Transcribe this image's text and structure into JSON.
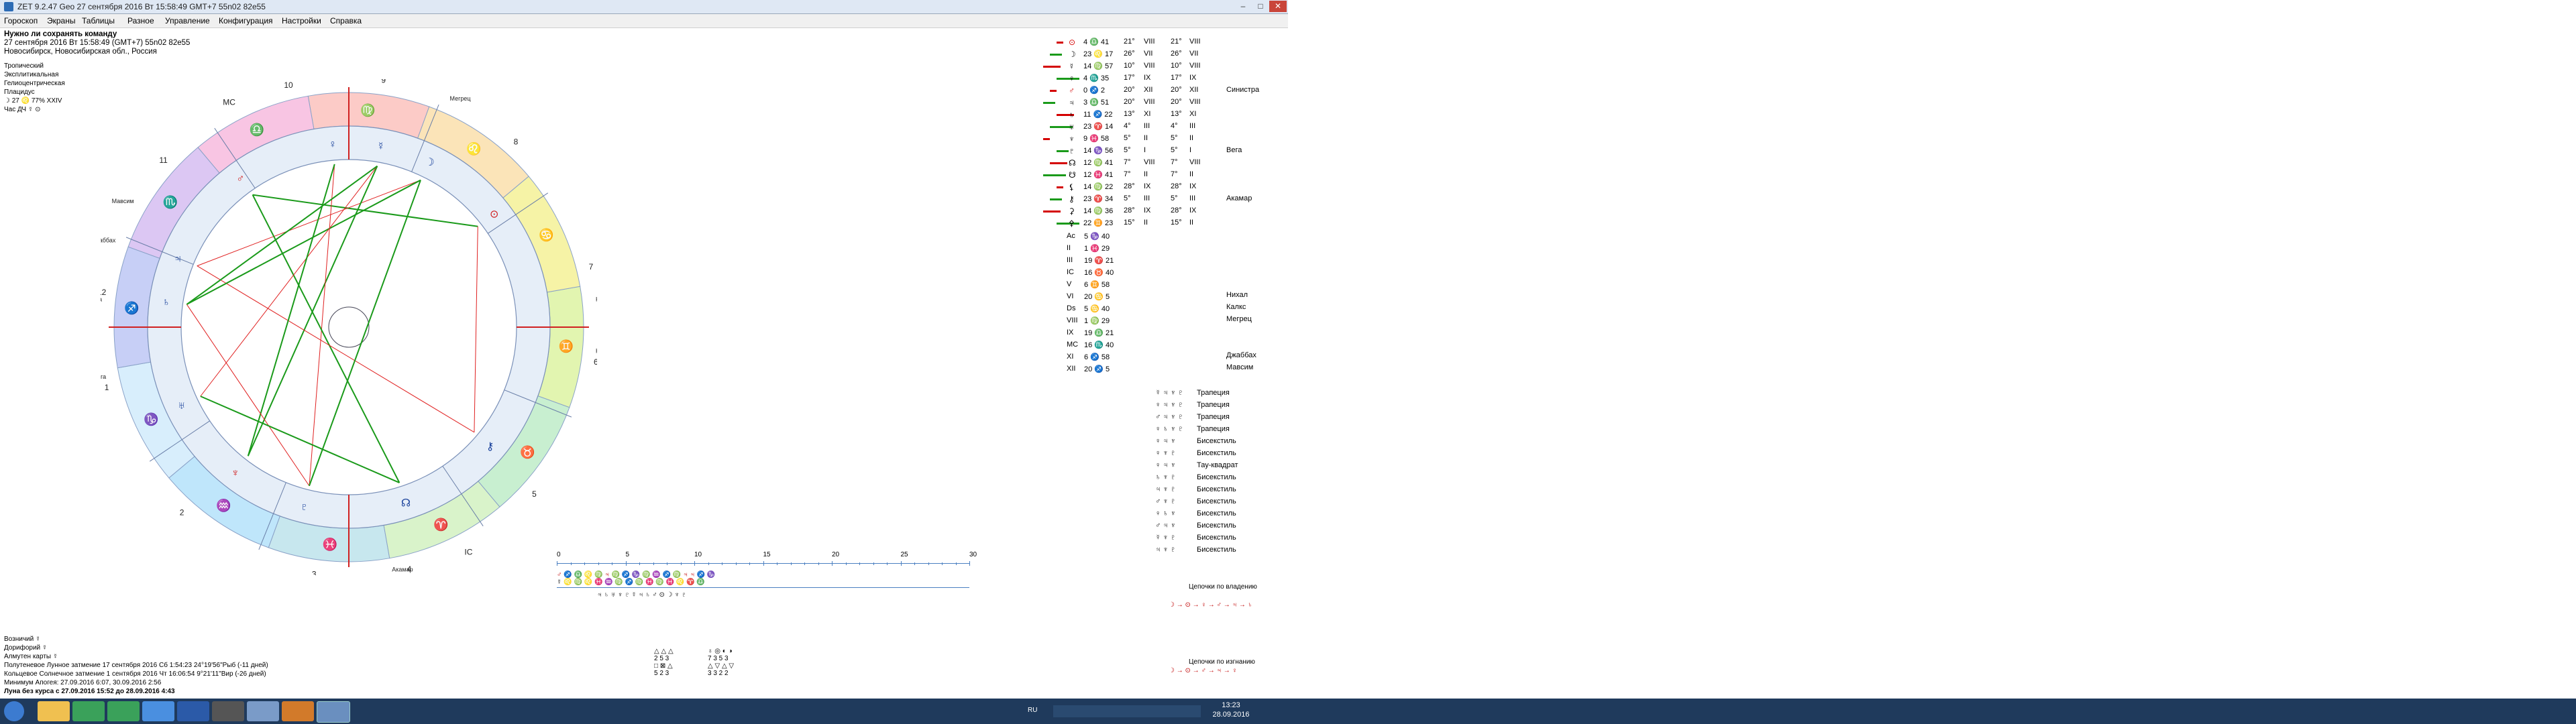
{
  "window": {
    "title": "ZET 9.2.47 Geo    27 сентября 2016  Вт  15:58:49 GMT+7 55n02  82e55",
    "controls": [
      "–",
      "□",
      "✕"
    ]
  },
  "menu": [
    "Гороскоп",
    "Экраны",
    "Таблицы",
    "Разное",
    "Управление",
    "Конфигурация",
    "Настройки",
    "Справка"
  ],
  "header": {
    "title": "Нужно ли сохранять команду",
    "datetime": "27 сентября 2016  Вт  15:58:49 (GMT+7) 55n02  82e55",
    "place": "Новосибирск, Новосибирская обл., Россия",
    "zodiac": "Тропический",
    "houses": "Эксплитикальная",
    "system": "Гелиоцентрическая",
    "extra": "Плацидус",
    "moon_line": "☽ 27 ♌ 77% XXIV",
    "hour_line": "Час ДЧ ☿ ⊙"
  },
  "bottom_info": {
    "line1": "Возничий ☿",
    "line2": "Дорифорий ☿",
    "line3": "Алмутен карты ☿",
    "line4": "Полутеневое Лунное затмение 17 сентября 2016 Сб  1:54:23 24°19'56\"Рыб (-11 дней)",
    "line5": "Кольцевое Солнечное затмение 1 сентября 2016 Чт 16:06:54  9°21'11\"Вир (-26 дней)",
    "line6": "Минимум Апогея: 27.09.2016  6:07,  30.09.2016  2:56",
    "line7": "Луна без курса с 27.09.2016 15:52 до 28.09.2016  4:43"
  },
  "element_table": {
    "row1_symbols": "△ △ △",
    "row1_values": "2 5 3",
    "row2_symbols": "□ ⊠ △",
    "row2_values": "5 2 3",
    "row3_symbols": "♁ ◎ ◐ ◑",
    "row3_values": "7 3 5 3",
    "row4_symbols": "△ ▽ △ ▽",
    "row4_values": "3 3 2 2"
  },
  "planets": [
    {
      "glyph": "⊙",
      "pos": "4 ♎ 41",
      "deg": "21°",
      "house": "VIII",
      "deg2": "21°",
      "house2": "VIII",
      "color": "#d40000"
    },
    {
      "glyph": "☽",
      "pos": "23 ♌ 17",
      "deg": "26°",
      "house": "VII",
      "deg2": "26°",
      "house2": "VII",
      "color": "#000"
    },
    {
      "glyph": "☿",
      "pos": "14 ♍ 57",
      "deg": "10°",
      "house": "VIII",
      "deg2": "10°",
      "house2": "VIII",
      "color": "#000"
    },
    {
      "glyph": "♀",
      "pos": "4 ♏ 35",
      "deg": "17°",
      "house": "IX",
      "deg2": "17°",
      "house2": "IX",
      "color": "#000"
    },
    {
      "glyph": "♂",
      "pos": "0 ♐ 2",
      "deg": "20°",
      "house": "XII",
      "deg2": "20°",
      "house2": "XII",
      "color": "#d40000"
    },
    {
      "glyph": "♃",
      "pos": "3 ♎ 51",
      "deg": "20°",
      "house": "VIII",
      "deg2": "20°",
      "house2": "VIII",
      "color": "#000"
    },
    {
      "glyph": "♄",
      "pos": "11 ♐ 22",
      "deg": "13°",
      "house": "XI",
      "deg2": "13°",
      "house2": "XI",
      "color": "#000"
    },
    {
      "glyph": "♅",
      "pos": "23 ♈ 14",
      "deg": "4°",
      "house": "III",
      "deg2": "4°",
      "house2": "III",
      "color": "#000"
    },
    {
      "glyph": "♆",
      "pos": "9 ♓ 58",
      "deg": "5°",
      "house": "II",
      "deg2": "5°",
      "house2": "II",
      "color": "#000"
    },
    {
      "glyph": "♇",
      "pos": "14 ♑ 56",
      "deg": "5°",
      "house": "I",
      "deg2": "5°",
      "house2": "I",
      "color": "#000"
    },
    {
      "glyph": "☊",
      "pos": "12 ♍ 41",
      "deg": "7°",
      "house": "VIII",
      "deg2": "7°",
      "house2": "VIII",
      "color": "#000"
    },
    {
      "glyph": "☋",
      "pos": "12 ♓ 41",
      "deg": "7°",
      "house": "II",
      "deg2": "7°",
      "house2": "II",
      "color": "#000"
    },
    {
      "glyph": "⚸",
      "pos": "14 ♍ 22",
      "deg": "28°",
      "house": "IX",
      "deg2": "28°",
      "house2": "IX",
      "color": "#000"
    },
    {
      "glyph": "⚷",
      "pos": "23 ♈ 34",
      "deg": "5°",
      "house": "III",
      "deg2": "5°",
      "house2": "III",
      "color": "#000"
    },
    {
      "glyph": "⚳",
      "pos": "14 ♍ 36",
      "deg": "28°",
      "house": "IX",
      "deg2": "28°",
      "house2": "IX",
      "color": "#000"
    },
    {
      "glyph": "⚴",
      "pos": "22 ♊ 23",
      "deg": "15°",
      "house": "II",
      "deg2": "15°",
      "house2": "II",
      "color": "#000"
    }
  ],
  "cusps": [
    {
      "glyph": "Ac",
      "pos": "5 ♑ 40"
    },
    {
      "glyph": "II",
      "pos": "1 ♓ 29"
    },
    {
      "glyph": "III",
      "pos": "19 ♈ 21"
    },
    {
      "glyph": "IC",
      "pos": "16 ♉ 40"
    },
    {
      "glyph": "V",
      "pos": "6 ♊ 58"
    },
    {
      "glyph": "VI",
      "pos": "20 ♋ 5"
    },
    {
      "glyph": "Ds",
      "pos": "5 ♋ 40"
    },
    {
      "glyph": "VIII",
      "pos": "1 ♍ 29"
    },
    {
      "glyph": "IX",
      "pos": "19 ♎ 21"
    },
    {
      "glyph": "MC",
      "pos": "16 ♏ 40"
    },
    {
      "glyph": "XI",
      "pos": "6 ♐ 58"
    },
    {
      "glyph": "XII",
      "pos": "20 ♐ 5"
    }
  ],
  "stars": [
    {
      "label": "Синистра",
      "row": 4
    },
    {
      "label": "Вега",
      "row": 9
    },
    {
      "label": "Акамар",
      "row": 13
    },
    {
      "label": "Нихал",
      "row": 21
    },
    {
      "label": "Калкс",
      "row": 22
    },
    {
      "label": "Мегрец",
      "row": 23
    },
    {
      "label": "Джаббах",
      "row": 26
    },
    {
      "label": "Мавсим",
      "row": 27
    }
  ],
  "configurations": [
    {
      "glyphs": "☿ ♃ ♆ ♇",
      "name": "Трапеция"
    },
    {
      "glyphs": "♀ ♃ ♆ ♇",
      "name": "Трапеция"
    },
    {
      "glyphs": "♂ ♃ ♆ ♇",
      "name": "Трапеция"
    },
    {
      "glyphs": "♀ ♄ ♆ ♇",
      "name": "Трапеция"
    },
    {
      "glyphs": "♀ ♃ ♆",
      "name": "Бисекстиль"
    },
    {
      "glyphs": "♀ ♆ ♇",
      "name": "Бисекстиль"
    },
    {
      "glyphs": "♀ ♃ ♆",
      "name": "Тау-квадрат"
    },
    {
      "glyphs": "♄ ♆ ♇",
      "name": "Бисекстиль"
    },
    {
      "glyphs": "♃ ♆ ♇",
      "name": "Бисекстиль"
    },
    {
      "glyphs": "♂ ♆ ♇",
      "name": "Бисекстиль"
    },
    {
      "glyphs": "♀ ♄ ♆",
      "name": "Бисекстиль"
    },
    {
      "glyphs": "♂ ♃ ♆",
      "name": "Бисекстиль"
    },
    {
      "glyphs": "☿ ♆ ♇",
      "name": "Бисекстиль"
    },
    {
      "glyphs": "♃ ♆ ♇",
      "name": "Бисекстиль"
    }
  ],
  "chains": {
    "label1": "Цепочки по владению",
    "chain1": "☽ → ⊙ → ♀ → ♂ → ♃ → ♄",
    "label2": "Цепочки по изгнанию",
    "chain2": "☽ → ⊙ → ♂ → ♃ → ♀"
  },
  "timeline": {
    "ticks": [
      "0",
      "5",
      "10",
      "15",
      "20",
      "25",
      "30"
    ],
    "row1": "♂   ♐ ♎ ♌ ♍   ♃ ♍ ♐ ♑ ♍ ♒ ♐ ♍   ♃   ♃   ♐ ♑",
    "row2": "☿   ♌ ♍ ♌   ♓ ♒ ♍ ♐ ♍ ♓   ♍   ♓ ♌ ♈ ♎",
    "row3": "♃ ♄ ♅ ♆ ♇   ☿   ♃ ♄   ♂ ⊙   ☽   ♆ ♇"
  },
  "wheel": {
    "signs_outer": [
      "♑",
      "♒",
      "♓",
      "♈",
      "♉",
      "♊",
      "♋",
      "♌",
      "♍",
      "♎",
      "♏",
      "♐"
    ],
    "house_numbers": [
      "1",
      "2",
      "3",
      "4",
      "5",
      "6",
      "7",
      "8",
      "9",
      "10",
      "11",
      "12"
    ],
    "angles": {
      "asc": "Asc",
      "mc": "MC",
      "ic": "IC",
      "ds": "Ds"
    },
    "star_labels": [
      "Синистра",
      "Джаббах",
      "Мавсим",
      "Вега",
      "Калкс",
      "Нихал",
      "Акамар",
      "Мегрец"
    ],
    "planet_glyphs": [
      "⊙",
      "☽",
      "☿",
      "♀",
      "♂",
      "♃",
      "♄",
      "♅",
      "♆",
      "♇",
      "☊",
      "⚷"
    ]
  },
  "taskbar": {
    "lang": "RU",
    "time": "13:23",
    "date": "28.09.2016"
  },
  "colors": {
    "wheel_signs": [
      "#d8eefc",
      "#bfe6fb",
      "#c7e7ee",
      "#d9f3ca",
      "#c8efd0",
      "#e2f5b0",
      "#f6f3a6",
      "#fbe4b8",
      "#fccbc7",
      "#f8c5e3",
      "#dcc7f3",
      "#c7cff6"
    ],
    "trine_green": "#1a9a1a",
    "square_red": "#e02020",
    "taskbar": "#1f3a5c"
  }
}
